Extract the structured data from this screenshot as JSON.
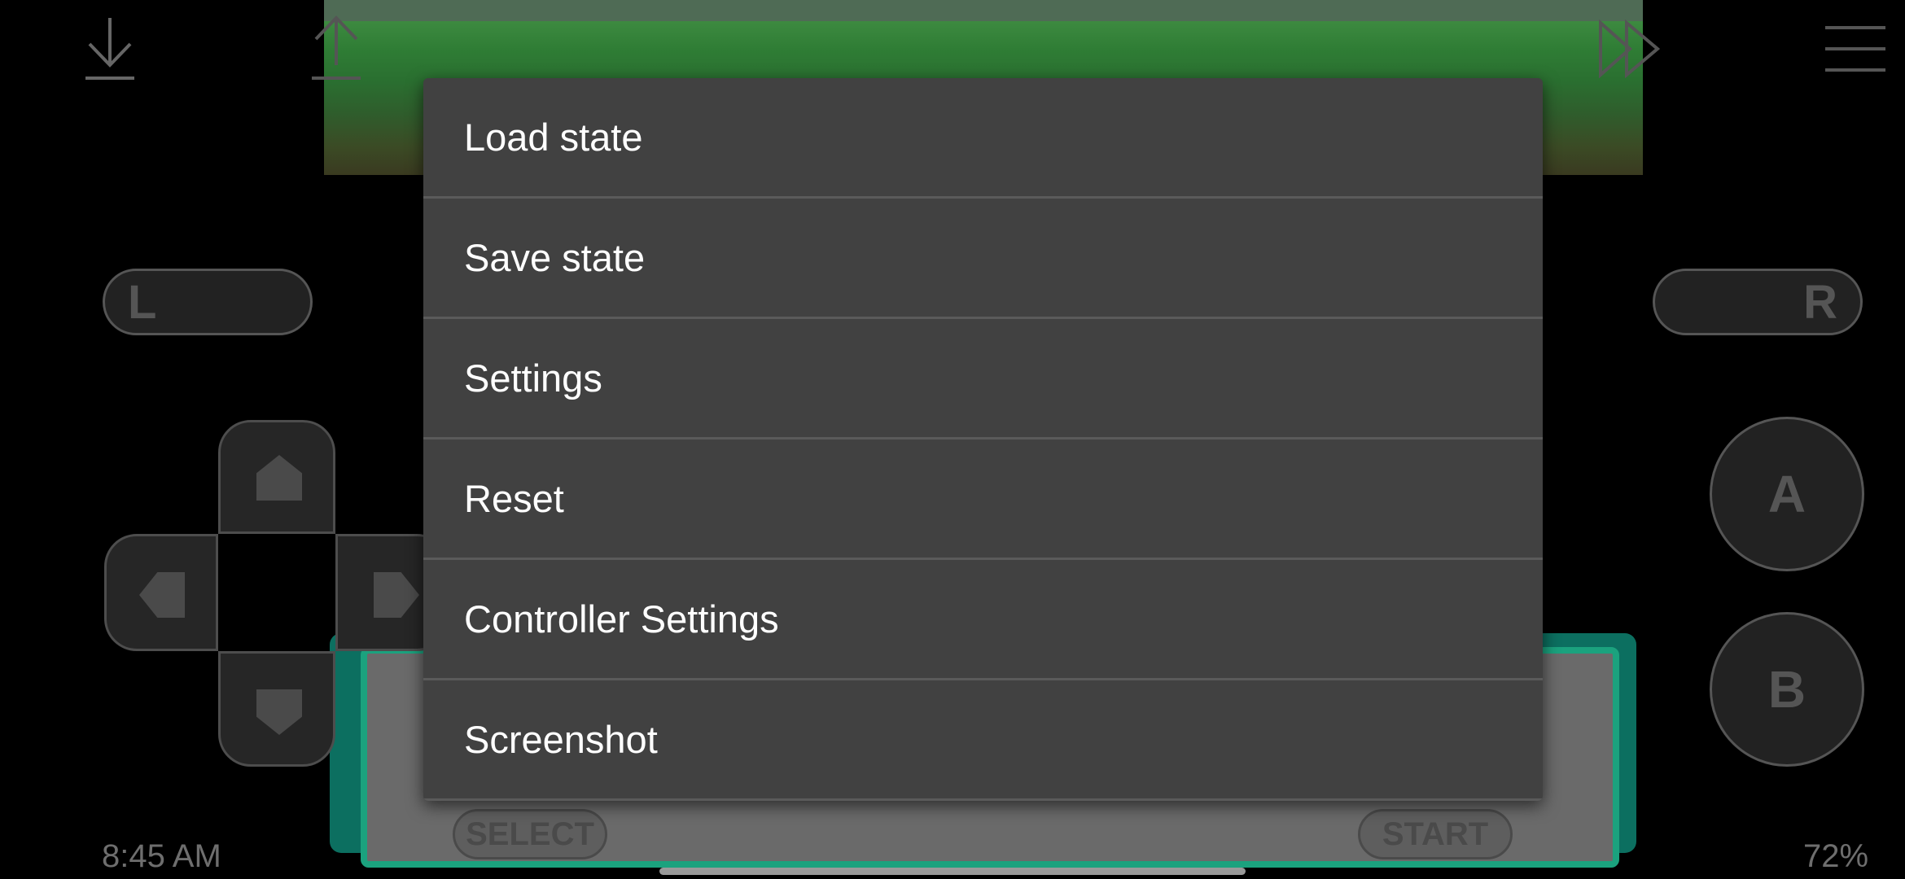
{
  "menu": {
    "items": [
      {
        "label": "Load state"
      },
      {
        "label": "Save state"
      },
      {
        "label": "Settings"
      },
      {
        "label": "Reset"
      },
      {
        "label": "Controller Settings"
      },
      {
        "label": "Screenshot"
      }
    ]
  },
  "controls": {
    "l_label": "L",
    "r_label": "R",
    "a_label": "A",
    "b_label": "B",
    "select_label": "SELECT",
    "start_label": "START"
  },
  "status": {
    "time": "8:45 AM",
    "battery": "72%"
  },
  "icons": {
    "load": "download-icon",
    "save": "upload-icon",
    "fast_forward": "fast-forward-icon",
    "menu": "hamburger-menu-icon"
  },
  "colors": {
    "menu_bg": "#414141",
    "menu_text": "#ffffff",
    "divider": "#5a5a5a"
  }
}
